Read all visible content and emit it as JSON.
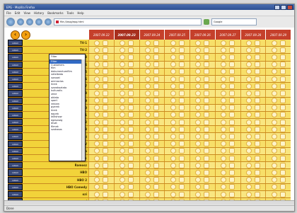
{
  "window": {
    "title": "EPG - Mozilla Firefox"
  },
  "menu": [
    "File",
    "Edit",
    "View",
    "History",
    "Bookmarks",
    "Tools",
    "Help"
  ],
  "address": {
    "url": "file:///epg/epg.html",
    "search_placeholder": "Google"
  },
  "grid": {
    "dates": [
      "2007.09.22",
      "2007.09.23",
      "2007.09.24",
      "2007.09.25",
      "2007.09.26",
      "2007.09.27",
      "2007.09.28",
      "2007.09.29"
    ],
    "today_index": 1,
    "channels": [
      "TV-1",
      "TV-2",
      "TV-3",
      "TV-4",
      "TV-5",
      "TV-6",
      "TV-7",
      "TV-8",
      "TV-9",
      "TV-10",
      "TV-11",
      "TV-12",
      "TV-13",
      "Discovery Travel",
      "Sport TV",
      "Filmmuzeum",
      "Film+",
      "Ramosz",
      "HBO",
      "HBO 2",
      "HBO Comedy",
      "ozi",
      "ozi"
    ],
    "logo_label": "LOGO"
  },
  "dropdown": {
    "selected": "Filter",
    "options": [
      "Filter",
      "Customers",
      "film",
      "dokumentumfilm",
      "vetelkedo",
      "sorozat",
      "animacios",
      "hirek",
      "szorakoztato",
      "kulturalis",
      "zene",
      "oktato",
      "sport",
      "reklam",
      "gyerek",
      "hirek",
      "egyeb",
      "talkshow",
      "egeszseg",
      "divat",
      "filmek",
      "szokasos"
    ],
    "highlight_index": 0
  },
  "status": {
    "text": "Done"
  }
}
